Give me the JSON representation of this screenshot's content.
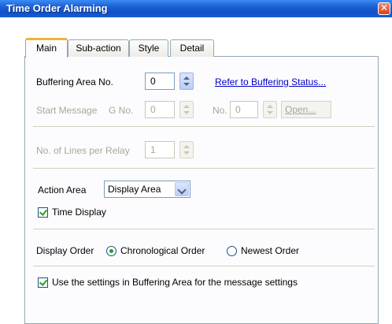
{
  "window": {
    "title": "Time Order Alarming",
    "close_glyph": "✕"
  },
  "tabs": [
    {
      "label": "Main",
      "active": true
    },
    {
      "label": "Sub-action",
      "active": false
    },
    {
      "label": "Style",
      "active": false
    },
    {
      "label": "Detail",
      "active": false
    }
  ],
  "buffering": {
    "label": "Buffering Area No.",
    "value": "0",
    "link": "Refer to Buffering Status..."
  },
  "start_message": {
    "label": "Start Message",
    "g_label": "G No.",
    "g_value": "0",
    "no_label": "No.",
    "no_value": "0",
    "open_label": "Open..."
  },
  "lines_per_relay": {
    "label": "No. of Lines per Relay",
    "value": "1"
  },
  "action_area": {
    "label": "Action Area",
    "selected": "Display Area"
  },
  "time_display": {
    "label": "Time Display",
    "checked": true
  },
  "display_order": {
    "label": "Display Order",
    "options": [
      {
        "label": "Chronological Order",
        "selected": true
      },
      {
        "label": "Newest Order",
        "selected": false
      }
    ]
  },
  "use_settings": {
    "label": "Use the settings in Buffering Area for the message settings",
    "checked": true
  },
  "colors": {
    "title_bar": "#0f50c8",
    "tab_highlight": "#f0b33c",
    "check_mark": "#21a121",
    "link": "#0000cc"
  }
}
